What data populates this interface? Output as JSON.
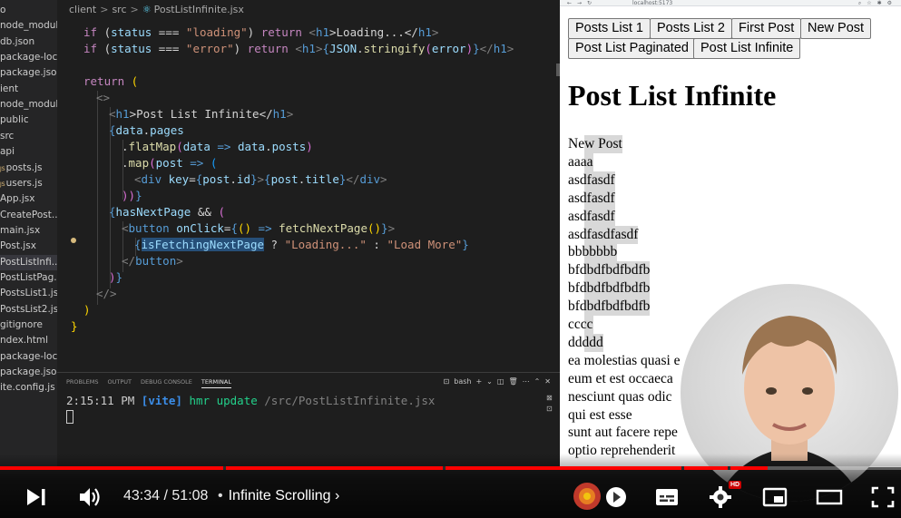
{
  "explorer": {
    "items": [
      {
        "label": "o",
        "active": false
      },
      {
        "label": "node_modul...",
        "active": false
      },
      {
        "label": "db.json",
        "active": false
      },
      {
        "label": "package-loc...",
        "active": false
      },
      {
        "label": "package.json",
        "active": false
      },
      {
        "label": "ient",
        "active": false
      },
      {
        "label": "node_modul...",
        "active": false
      },
      {
        "label": "public",
        "active": false
      },
      {
        "label": "src",
        "active": false
      },
      {
        "label": "api",
        "active": false
      },
      {
        "label": "posts.js",
        "active": false,
        "icon": "js"
      },
      {
        "label": "users.js",
        "active": false,
        "icon": "js"
      },
      {
        "label": "App.jsx",
        "active": false
      },
      {
        "label": "CreatePost....",
        "active": false
      },
      {
        "label": "main.jsx",
        "active": false
      },
      {
        "label": "Post.jsx",
        "active": false
      },
      {
        "label": "PostListInfi...",
        "active": true
      },
      {
        "label": "PostListPag...",
        "active": false
      },
      {
        "label": "PostsList1.jsx",
        "active": false
      },
      {
        "label": "PostsList2.jsx",
        "active": false
      },
      {
        "label": "gitignore",
        "active": false
      },
      {
        "label": "ndex.html",
        "active": false
      },
      {
        "label": "package-loc...",
        "active": false
      },
      {
        "label": "package.json",
        "active": false
      },
      {
        "label": "ite.config.js",
        "active": false
      }
    ]
  },
  "breadcrumb": {
    "part1": "client",
    "part2": "src",
    "file": "PostListInfinite.jsx",
    "separator": ">"
  },
  "code": {
    "l1": {
      "a": "if",
      "b": " (",
      "c": "status",
      "d": " === ",
      "e": "\"loading\"",
      "f": ") ",
      "g": "return",
      "h": " <",
      "i": "h1",
      "j": ">Loading...</",
      "k": "h1",
      "l": ">"
    },
    "l2": {
      "a": "if",
      "b": " (",
      "c": "status",
      "d": " === ",
      "e": "\"error\"",
      "f": ") ",
      "g": "return",
      "h": " <",
      "i": "h1",
      "j": ">",
      "k": "{",
      "l": "JSON",
      "m": ".",
      "n": "stringify",
      "o": "(",
      "p": "error",
      "q": ")",
      "r": "}",
      "s": "</",
      "t": "h1",
      "u": ">"
    },
    "l3": {
      "a": "return",
      "b": " ("
    },
    "l4": {
      "a": "<>"
    },
    "l5": {
      "a": "<",
      "b": "h1",
      "c": ">Post List Infinite</",
      "d": "h1",
      "e": ">"
    },
    "l6": {
      "a": "{",
      "b": "data",
      "c": ".",
      "d": "pages"
    },
    "l7": {
      "a": ".",
      "b": "flatMap",
      "c": "(",
      "d": "data",
      "e": " => ",
      "f": "data",
      "g": ".",
      "h": "posts",
      "i": ")"
    },
    "l8": {
      "a": ".",
      "b": "map",
      "c": "(",
      "d": "post",
      "e": " => ",
      "f": "("
    },
    "l9": {
      "a": "<",
      "b": "div",
      "c": " key",
      "d": "=",
      "e": "{",
      "f": "post",
      "g": ".",
      "h": "id",
      "i": "}",
      "j": ">",
      "k": "{",
      "l": "post",
      "m": ".",
      "n": "title",
      "o": "}",
      "p": "</",
      "q": "div",
      "r": ">"
    },
    "l10": {
      "a": "))",
      "b": "}"
    },
    "l11": {
      "a": "{",
      "b": "hasNextPage",
      "c": " && ",
      "d": "("
    },
    "l12": {
      "a": "<",
      "b": "button",
      "c": " onClick",
      "d": "=",
      "e": "{",
      "f": "()",
      "g": " => ",
      "h": "fetchNextPage",
      "i": "()",
      "j": "}",
      "k": ">"
    },
    "l13": {
      "a": "{",
      "b": "isFetchingNextPage",
      "c": " ? ",
      "d": "\"Loading...\"",
      "e": " : ",
      "f": "\"Load More\"",
      "g": "}"
    },
    "l14": {
      "a": "</",
      "b": "button",
      "c": ">"
    },
    "l15": {
      "a": ")",
      "b": "}"
    },
    "l16": {
      "a": "</>"
    },
    "l17": {
      "a": ")"
    },
    "l18": {
      "a": "}"
    }
  },
  "panel": {
    "tabs": [
      "PROBLEMS",
      "OUTPUT",
      "DEBUG CONSOLE",
      "TERMINAL"
    ],
    "shell": "bash",
    "terminal": {
      "time": "2:15:11 PM",
      "tag": "[vite]",
      "msg": "hmr update",
      "path": "/src/PostListInfinite.jsx"
    }
  },
  "browser": {
    "url": "localhost:5173",
    "buttons": [
      "Posts List 1",
      "Posts List 2",
      "First Post",
      "New Post",
      "Post List Paginated",
      "Post List Infinite"
    ],
    "title": "Post List Infinite",
    "posts": [
      "New Post",
      "aaaa",
      "asdfasdf",
      "asdfasdf",
      "asdfasdf",
      "asdfasdfasdf",
      "bbbbbbb",
      "bfdbdfbdfbdfb",
      "bfdbdfbdfbdfb",
      "bfdbdfbdfbdfb",
      "cccc",
      "ddddd",
      "ea molestias quasi e",
      "eum et est occaeca",
      "nesciunt quas odic",
      "qui est esse",
      "sunt aut facere repe",
      "optio reprehenderit"
    ]
  },
  "player": {
    "current_time": "43:34",
    "separator": " / ",
    "duration": "51:08",
    "chapter_dot": "•",
    "chapter": "Infinite Scrolling",
    "chapter_arrow": "›",
    "hd_badge": "HD",
    "progress_fraction": 0.852,
    "accent": "#ff0000"
  },
  "icons": [
    "play-next-icon",
    "volume-icon",
    "channel-logo",
    "autoplay-toggle-icon",
    "subtitles-icon",
    "settings-gear-icon",
    "miniplayer-icon",
    "theater-mode-icon",
    "fullscreen-icon"
  ]
}
